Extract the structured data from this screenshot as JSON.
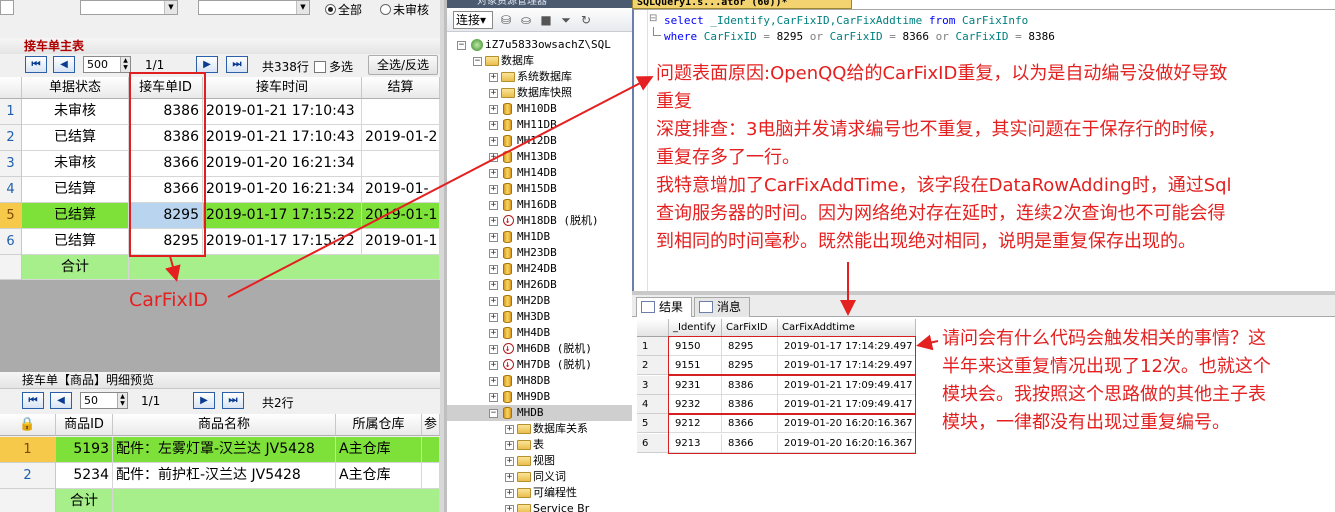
{
  "top_filter": {
    "radio_all": "全部",
    "radio_unreviewed": "未审核"
  },
  "master": {
    "title": "接车单主表",
    "page_size": "500",
    "page_info": "1/1",
    "total": "共338行",
    "multi_select": "多选",
    "select_all_btn": "全选/反选",
    "columns": [
      "单据状态",
      "接车单ID",
      "接车时间",
      "结算"
    ],
    "rows": [
      {
        "n": "1",
        "status": "未审核",
        "id": "8386",
        "time": "2019-01-21 17:10:43",
        "settle": ""
      },
      {
        "n": "2",
        "status": "已结算",
        "id": "8386",
        "time": "2019-01-21 17:10:43",
        "settle": "2019-01-2"
      },
      {
        "n": "3",
        "status": "未审核",
        "id": "8366",
        "time": "2019-01-20 16:21:34",
        "settle": ""
      },
      {
        "n": "4",
        "status": "已结算",
        "id": "8366",
        "time": "2019-01-20 16:21:34",
        "settle": "2019-01-"
      },
      {
        "n": "5",
        "status": "已结算",
        "id": "8295",
        "time": "2019-01-17 17:15:22",
        "settle": "2019-01-1"
      },
      {
        "n": "6",
        "status": "已结算",
        "id": "8295",
        "time": "2019-01-17 17:15:22",
        "settle": "2019-01-1"
      }
    ],
    "sum_label": "合计"
  },
  "detail": {
    "title": "接车单【商品】明细预览",
    "page_size": "50",
    "page_info": "1/1",
    "total": "共2行",
    "columns": [
      "商品ID",
      "商品名称",
      "所属仓库",
      "参"
    ],
    "rows": [
      {
        "n": "1",
        "id": "5193",
        "name": "配件：左雾灯罩-汉兰达 JV5428",
        "warehouse": "A主仓库"
      },
      {
        "n": "2",
        "id": "5234",
        "name": "配件：前护杠-汉兰达 JV5428",
        "warehouse": "A主仓库"
      }
    ],
    "sum_label": "合计"
  },
  "explorer": {
    "title": "对象资源管理器",
    "connect": "连接",
    "server": "iZ7u5833owsachZ\\SQL",
    "databases": "数据库",
    "items": [
      {
        "label": "系统数据库",
        "type": "folder"
      },
      {
        "label": "数据库快照",
        "type": "folder"
      },
      {
        "label": "MH10DB",
        "type": "db"
      },
      {
        "label": "MH11DB",
        "type": "db"
      },
      {
        "label": "MH12DB",
        "type": "db"
      },
      {
        "label": "MH13DB",
        "type": "db"
      },
      {
        "label": "MH14DB",
        "type": "db"
      },
      {
        "label": "MH15DB",
        "type": "db"
      },
      {
        "label": "MH16DB",
        "type": "db"
      },
      {
        "label": "MH18DB (脱机)",
        "type": "off"
      },
      {
        "label": "MH1DB",
        "type": "db"
      },
      {
        "label": "MH23DB",
        "type": "db"
      },
      {
        "label": "MH24DB",
        "type": "db"
      },
      {
        "label": "MH26DB",
        "type": "db"
      },
      {
        "label": "MH2DB",
        "type": "db"
      },
      {
        "label": "MH3DB",
        "type": "db"
      },
      {
        "label": "MH4DB",
        "type": "db"
      },
      {
        "label": "MH6DB (脱机)",
        "type": "off"
      },
      {
        "label": "MH7DB (脱机)",
        "type": "off"
      },
      {
        "label": "MH8DB",
        "type": "db"
      },
      {
        "label": "MH9DB",
        "type": "db"
      },
      {
        "label": "MHDB",
        "type": "db"
      }
    ],
    "sub_items": [
      "数据库关系",
      "表",
      "视图",
      "同义词",
      "可编程性",
      "Service Br"
    ]
  },
  "query": {
    "tab_title": "SQLQuery1.s...ator (60))*",
    "line1": [
      "select",
      " _Identify,CarFixID,CarFixAddtime ",
      "from",
      " CarFixInfo"
    ],
    "line2": [
      "where",
      " CarFixID ",
      "=",
      " 8295 ",
      "or",
      " CarFixID ",
      "=",
      " 8366 ",
      "or",
      " CarFixID ",
      "=",
      " 8386"
    ]
  },
  "results": {
    "tab_results": "结果",
    "tab_messages": "消息",
    "columns": [
      "_Identify",
      "CarFixID",
      "CarFixAddtime"
    ],
    "rows": [
      {
        "n": "1",
        "identify": "9150",
        "carfixid": "8295",
        "addtime": "2019-01-17 17:14:29.497"
      },
      {
        "n": "2",
        "identify": "9151",
        "carfixid": "8295",
        "addtime": "2019-01-17 17:14:29.497"
      },
      {
        "n": "3",
        "identify": "9231",
        "carfixid": "8386",
        "addtime": "2019-01-21 17:09:49.417"
      },
      {
        "n": "4",
        "identify": "9232",
        "carfixid": "8386",
        "addtime": "2019-01-21 17:09:49.417"
      },
      {
        "n": "5",
        "identify": "9212",
        "carfixid": "8366",
        "addtime": "2019-01-20 16:20:16.367"
      },
      {
        "n": "6",
        "identify": "9213",
        "carfixid": "8366",
        "addtime": "2019-01-20 16:20:16.367"
      }
    ]
  },
  "annotations": {
    "carfixid_label": "CarFixID",
    "note_main": [
      "问题表面原因:OpenQQ给的CarFixID重复，以为是自动编号没做好导致",
      "重复",
      "深度排查：3电脑并发请求编号也不重复，其实问题在于保存行的时候，",
      "重复存多了一行。",
      "我特意增加了CarFixAddTime，该字段在DataRowAdding时，通过Sql",
      "查询服务器的时间。因为网络绝对存在延时，连续2次查询也不可能会得",
      "到相同的时间毫秒。既然能出现绝对相同，说明是重复保存出现的。"
    ],
    "note_question": [
      "请问会有什么代码会触发相关的事情？这",
      "半年来这重复情况出现了12次。也就这个",
      "模块会。我按照这个思路做的其他主子表",
      "模块，一律都没有出现过重复编号。"
    ]
  }
}
